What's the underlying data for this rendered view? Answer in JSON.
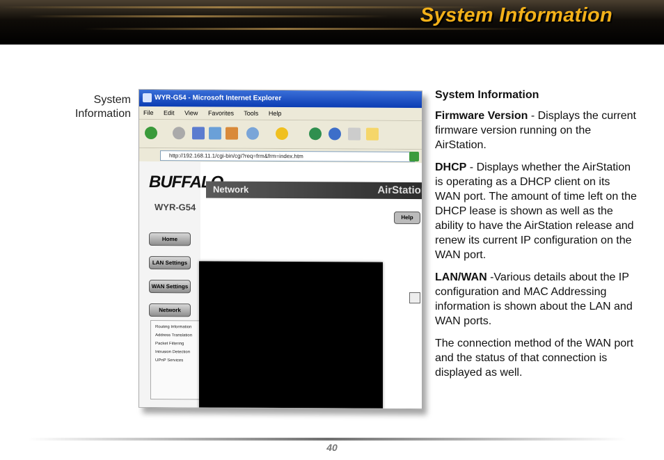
{
  "header": {
    "title": "System Information"
  },
  "side_caption": {
    "line1": "System",
    "line2": "Information"
  },
  "screenshot": {
    "window_title": "WYR-G54 - Microsoft Internet Explorer",
    "menu": [
      "File",
      "Edit",
      "View",
      "Favorites",
      "Tools",
      "Help"
    ],
    "address": "http://192.168.11.1/cgi-bin/cgi?req=frm&frm=index.htm",
    "logo": "BUFFALO.",
    "model": "WYR-G54",
    "nav": [
      "Home",
      "LAN Settings",
      "WAN Settings",
      "Network"
    ],
    "submenu": [
      "Routing Information",
      "Address Translation",
      "Packet Filtering",
      "Intrusion Detection",
      "UPnP Services"
    ],
    "page_heading": "Network",
    "brand_label": "AirStation",
    "help": "Help"
  },
  "text": {
    "heading": "System Information",
    "firmware_term": "Firmware Version",
    "firmware_desc": " - Displays the current firmware version running on the AirStation.",
    "dhcp_term": "DHCP",
    "dhcp_desc": " - Displays whether the AirStation is operating as a DHCP client on its WAN port. The amount of time left on the DHCP lease is shown as well as the ability to have the AirStation release and renew its current IP configuration on the WAN port.",
    "lanwan_term": "LAN/WAN",
    "lanwan_desc": " -Various details about the IP configuration and MAC Addressing information is shown about the LAN and WAN ports.",
    "closing": "The connection method of the WAN port and the status of that connection is displayed as well."
  },
  "footer": {
    "page_number": "40"
  },
  "colors": {
    "title": "#f2b019",
    "header_bg": "#000000"
  }
}
